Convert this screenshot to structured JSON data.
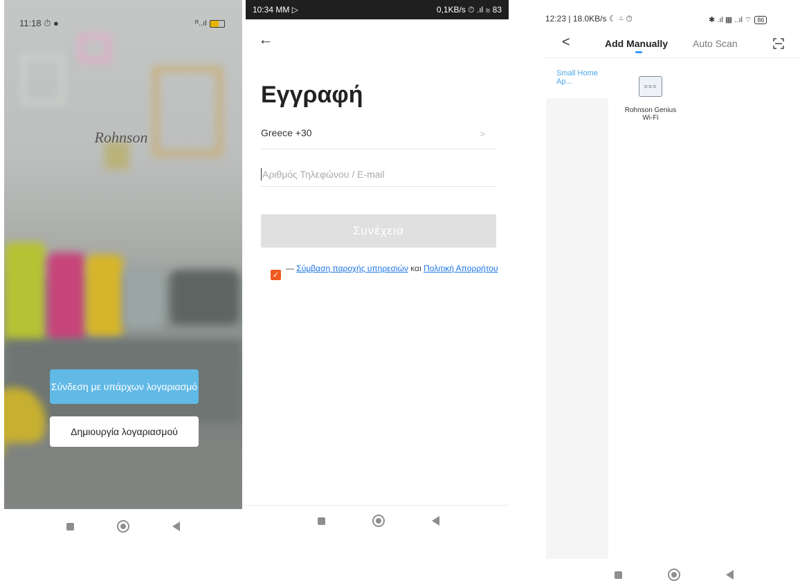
{
  "panel1": {
    "time": "11:18",
    "status_icons": "⏱ ●",
    "signal": "ᴿ..ıl",
    "brand": "Rohnson",
    "login_button": "Σύνδεση με υπάρχων λογαριασμό",
    "create_button": "Δημιουργία λογαριασμού"
  },
  "panel2": {
    "time": "10:34 MM ▷",
    "network_status": "0,1KB/s ⏱ .ıl ≋ 83",
    "title": "Εγγραφή",
    "country": "Greece +30",
    "phone_placeholder": "Αριθμός Τηλεφώνου / E-mail",
    "continue_button": "Συνέχεια",
    "terms_prefix": "— ",
    "terms_link1": "Σύμβαση παροχής υπηρεσιών",
    "terms_mid": " και ",
    "terms_link2": "Πολιτική Απορρήτου"
  },
  "panel3": {
    "status_left": "12:23 | 18.0KB/s ☾ ⍨ ⏱",
    "status_right": "✱ .ıl ▦ ..ıl ⌔",
    "battery": "86",
    "tab_manual": "Add Manually",
    "tab_auto": "Auto Scan",
    "category": "Small Home Ap...",
    "device_name": "Rohnson Genius Wi-Fi"
  },
  "colors": {
    "login_blue": "#61b9e6",
    "check_orange": "#f05a22",
    "link_blue": "#1a73e8",
    "tab_accent": "#3399ff",
    "category_blue": "#4aa6e8"
  }
}
